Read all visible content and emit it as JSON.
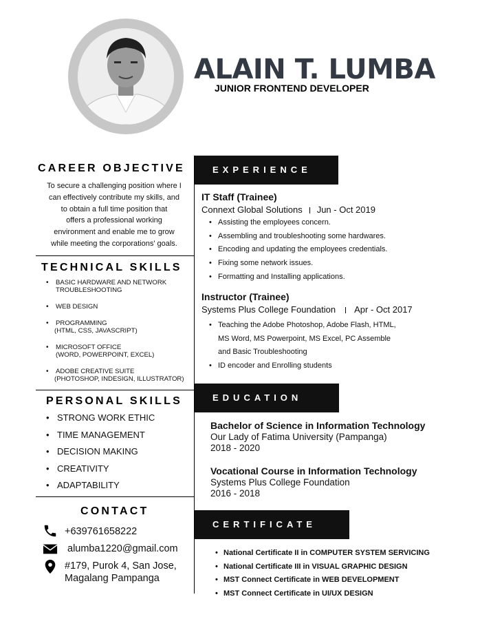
{
  "header": {
    "name": "ALAIN T. LUMBA",
    "role": "JUNIOR FRONTEND DEVELOPER"
  },
  "career_objective": {
    "heading": "CAREER OBJECTIVE",
    "lines": [
      "To secure a challenging position where I",
      "can effectively contribute my skills, and",
      "to obtain a full time position that",
      "offers a professional working",
      "environment and enable me to grow",
      "while meeting the corporations' goals."
    ]
  },
  "technical_skills": {
    "heading": "TECHNICAL SKILLS",
    "items": [
      {
        "main": "BASIC HARDWARE AND NETWORK",
        "sub": "TROUBLESHOOTING"
      },
      {
        "main": "WEB DESIGN",
        "sub": ""
      },
      {
        "main": "PROGRAMMING",
        "sub": "(HTML, CSS, JAVASCRIPT)"
      },
      {
        "main": "MICROSOFT OFFICE",
        "sub": "(WORD, POWERPOINT, EXCEL)"
      },
      {
        "main": "ADOBE CREATIVE SUITE",
        "sub": "(PHOTOSHOP, INDESIGN, ILLUSTRATOR)"
      }
    ]
  },
  "personal_skills": {
    "heading": "PERSONAL SKILLS",
    "items": [
      "STRONG WORK ETHIC",
      "TIME MANAGEMENT",
      "DECISION MAKING",
      "CREATIVITY",
      "ADAPTABILITY"
    ]
  },
  "contact": {
    "heading": "CONTACT",
    "phone": "+639761658222",
    "email": "alumba1220@gmail.com",
    "address_line1": "#179, Purok 4, San Jose,",
    "address_line2": "Magalang Pampanga",
    "icons": [
      "phone-icon",
      "email-icon",
      "location-icon"
    ]
  },
  "experience": {
    "heading": "EXPERIENCE",
    "jobs": [
      {
        "title": "IT Staff  (Trainee)",
        "org": "Connext Global Solutions",
        "dates": "Jun - Oct 2019",
        "bullets": [
          "Assisting the employees concern.",
          "Assembling and troubleshooting some hardwares.",
          "Encoding and updating the employees credentials.",
          "Fixing some network issues.",
          "Formatting and Installing applications."
        ]
      },
      {
        "title": "Instructor (Trainee)",
        "org": "Systems Plus College Foundation",
        "dates": "Apr - Oct 2017",
        "bullets": [
          "Teaching the Adobe Photoshop, Adobe Flash, HTML,",
          "ID encoder and Enrolling students"
        ],
        "bullet1_cont": [
          "MS Word, MS Powerpoint, MS Excel, PC Assemble",
          "and Basic Troubleshooting"
        ]
      }
    ]
  },
  "education": {
    "heading": "EDUCATION",
    "entries": [
      {
        "degree": "Bachelor of Science in Information Technology",
        "school": "Our Lady of Fatima University (Pampanga)",
        "years": "2018 - 2020"
      },
      {
        "degree": "Vocational Course in Information Technology",
        "school": "Systems Plus College Foundation",
        "years": "2016 - 2018"
      }
    ]
  },
  "certificate": {
    "heading": "CERTIFICATE",
    "items": [
      "National Certificate II in COMPUTER SYSTEM SERVICING",
      "National Certificate III in VISUAL GRAPHIC DESIGN",
      "MST Connect Certificate in WEB DEVELOPMENT",
      "MST Connect Certificate in UI/UX DESIGN"
    ]
  }
}
